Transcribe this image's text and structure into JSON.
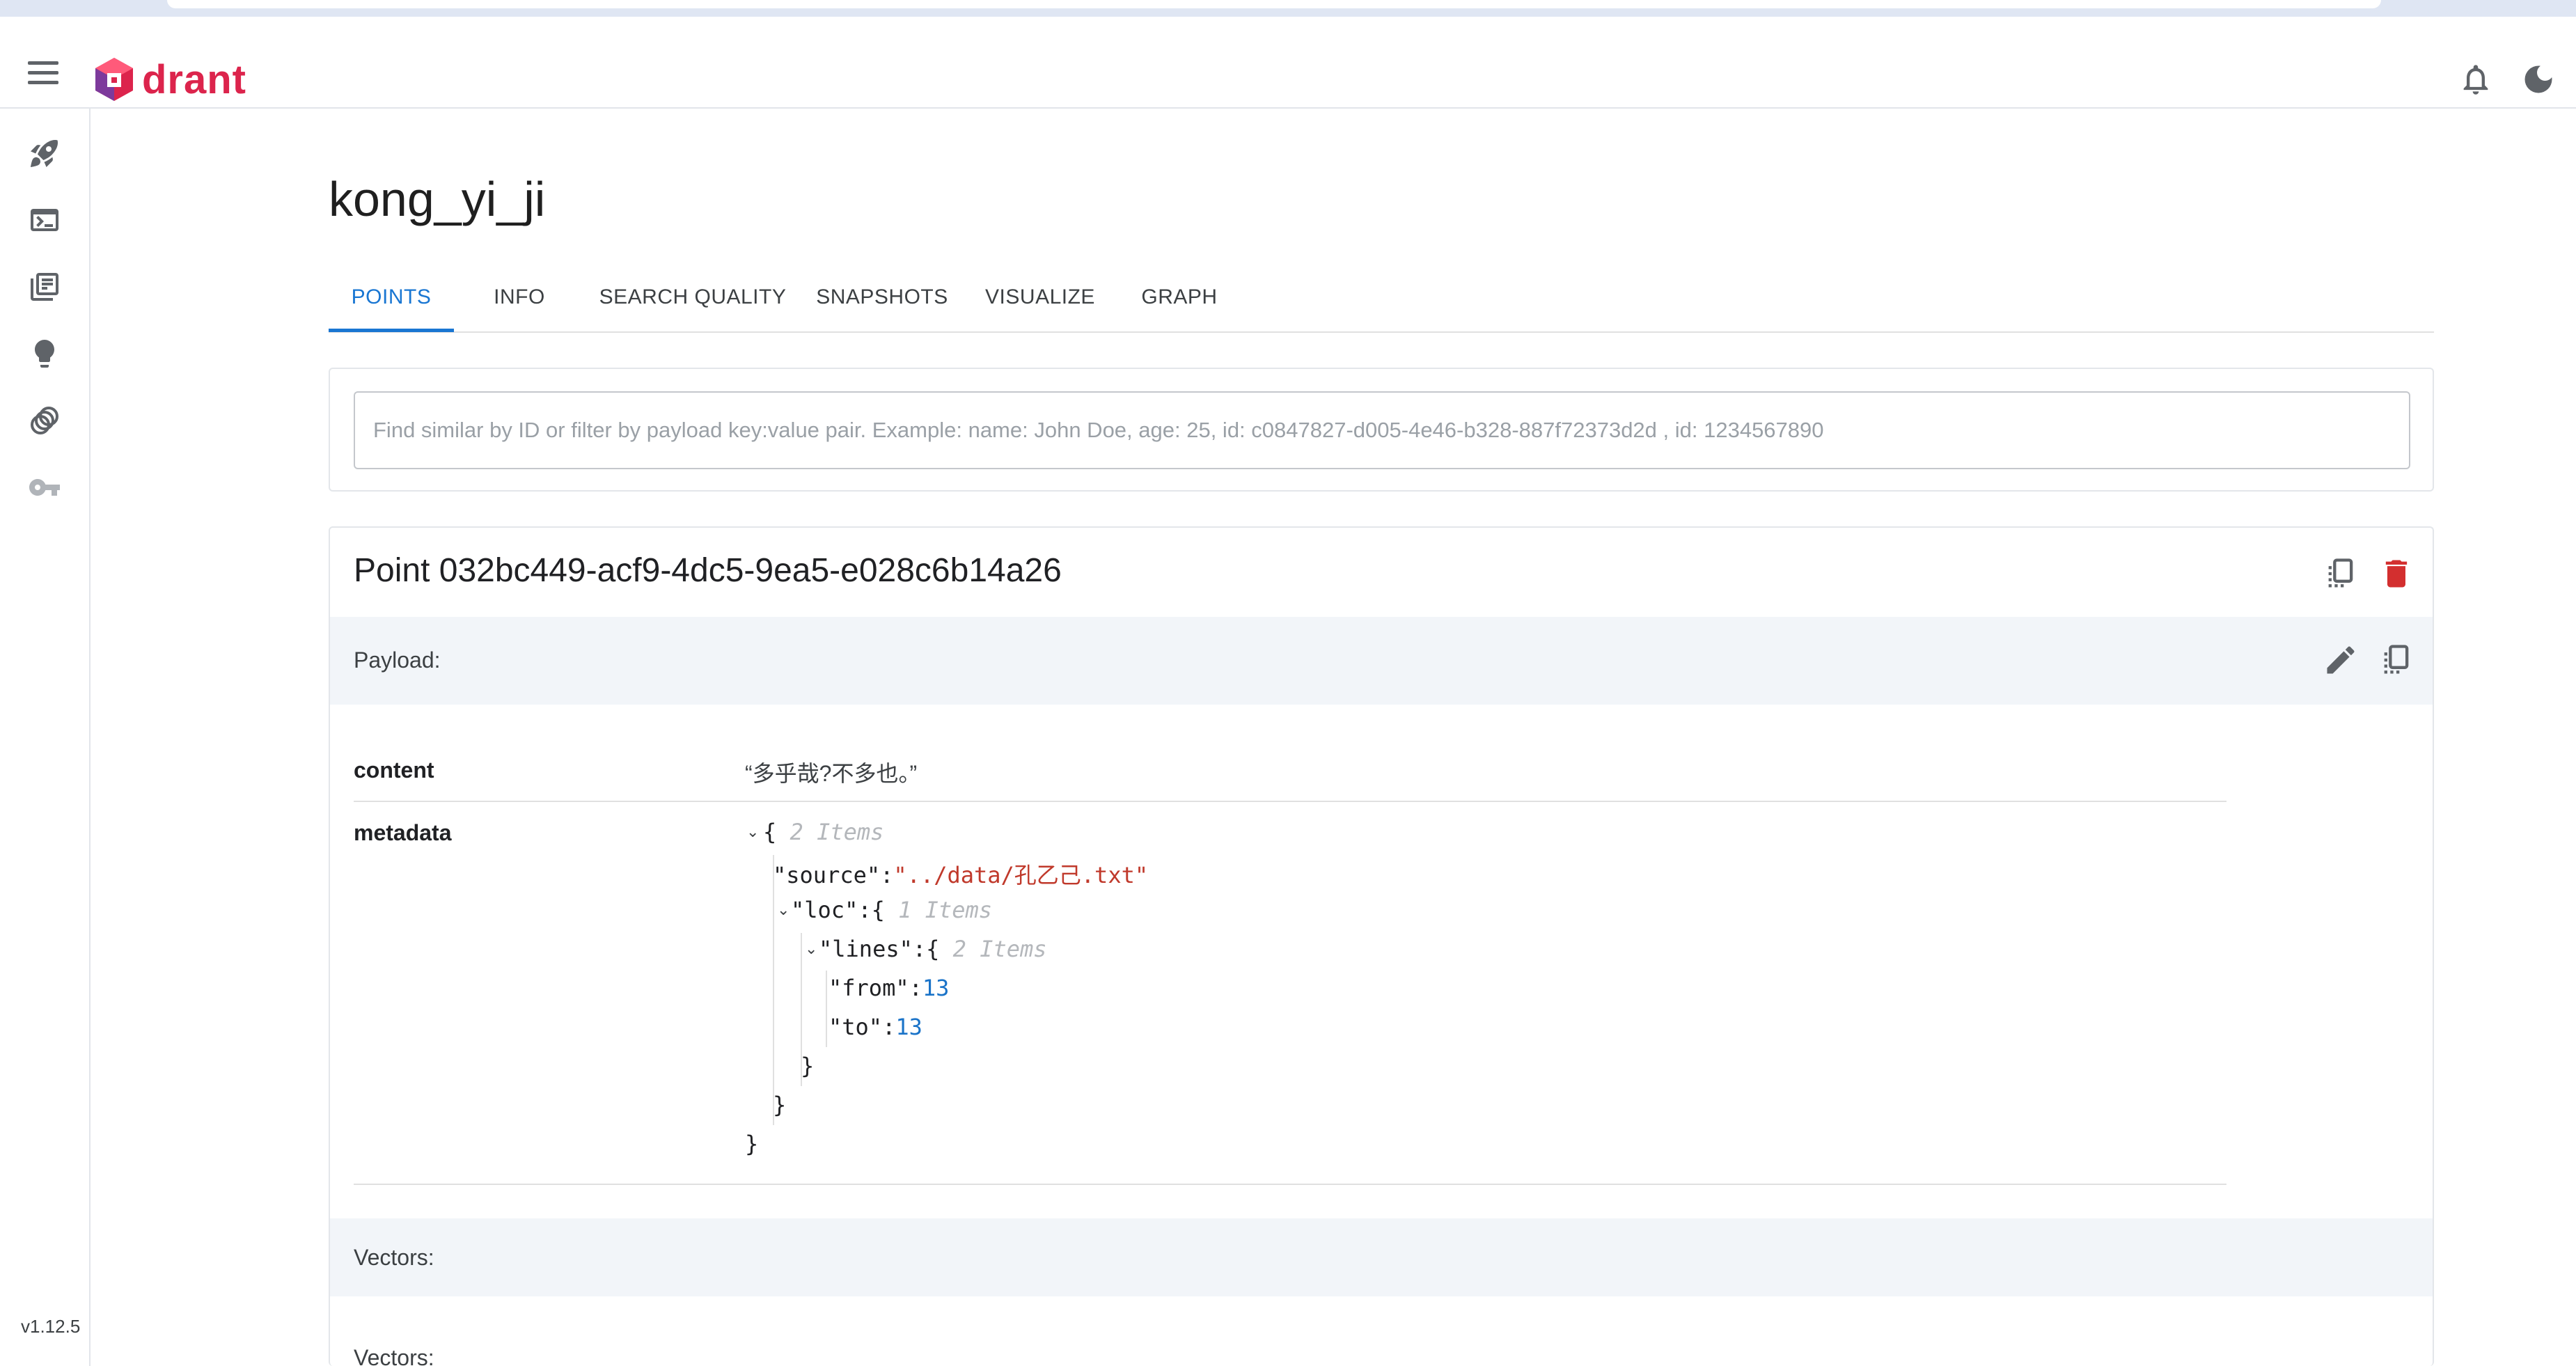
{
  "app": {
    "logo_text": "drant",
    "version": "v1.12.5",
    "colors": {
      "brand": "#dc244c",
      "accent": "#1976d2",
      "delete": "#d32f2f"
    }
  },
  "header": {
    "icons": [
      "menu-icon",
      "bell-icon",
      "moon-icon"
    ]
  },
  "sidebar": {
    "items": [
      {
        "icon": "rocket-icon"
      },
      {
        "icon": "console-icon"
      },
      {
        "icon": "collections-icon"
      },
      {
        "icon": "lightbulb-icon"
      },
      {
        "icon": "datasets-icon"
      },
      {
        "icon": "key-icon"
      }
    ]
  },
  "collection": {
    "title": "kong_yi_ji",
    "tabs": [
      "POINTS",
      "INFO",
      "SEARCH QUALITY",
      "SNAPSHOTS",
      "VISUALIZE",
      "GRAPH"
    ],
    "active_tab": "POINTS"
  },
  "search": {
    "placeholder": "Find similar by ID or filter by payload key:value pair. Example: name: John Doe, age: 25, id: c0847827-d005-4e46-b328-887f72373d2d , id: 1234567890",
    "value": ""
  },
  "point": {
    "title": "Point 032bc449-acf9-4dc5-9ea5-e028c6b14a26",
    "payload_label": "Payload:",
    "payload": {
      "content_key": "content",
      "content_value": "“多乎哉?不多也。”",
      "metadata_key": "metadata",
      "metadata": {
        "open_brace": "{",
        "count_root": "2 Items",
        "source_key": "\"source\"",
        "source_value": "\"../data/孔乙己.txt\"",
        "loc_key": "\"loc\"",
        "count_loc": "1 Items",
        "lines_key": "\"lines\"",
        "count_lines": "2 Items",
        "from_key": "\"from\"",
        "from_value": "13",
        "to_key": "\"to\"",
        "to_value": "13",
        "close_brace": "}",
        "colon": ":"
      }
    },
    "vectors_label": "Vectors:",
    "vectors_sub_label": "Vectors:"
  }
}
